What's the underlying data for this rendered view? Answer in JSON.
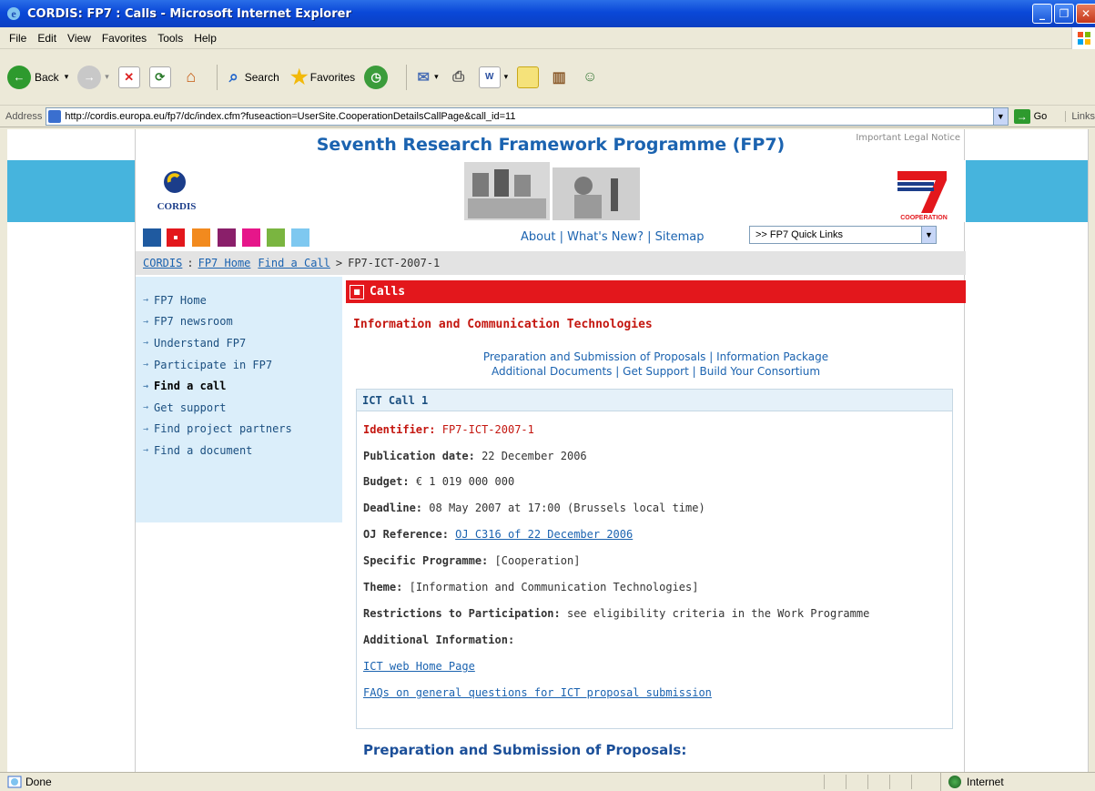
{
  "window": {
    "title": "CORDIS: FP7 : Calls - Microsoft Internet Explorer",
    "controls": [
      "minimize",
      "restore",
      "close"
    ]
  },
  "menu": [
    "File",
    "Edit",
    "View",
    "Favorites",
    "Tools",
    "Help"
  ],
  "toolbar": {
    "back": "Back",
    "search": "Search",
    "favorites": "Favorites"
  },
  "address": {
    "label": "Address",
    "url": "http://cordis.europa.eu/fp7/dc/index.cfm?fuseaction=UserSite.CooperationDetailsCallPage&call_id=11",
    "go": "Go",
    "links": "Links"
  },
  "header": {
    "title": "Seventh Research Framework Programme (FP7)",
    "legal": "Important Legal Notice",
    "cordis_logo": "CORDIS",
    "cooperation_badge": "COOPERATION",
    "swatch_colors": [
      "#1f5aa0",
      "#e3171c",
      "#f28a1e",
      "#8a1f6a",
      "#e6168a",
      "#7ab540",
      "#7ec8f0"
    ]
  },
  "toplinks": {
    "about": "About",
    "whats_new": "What's New?",
    "sitemap": "Sitemap",
    "sep": "|"
  },
  "quicklinks": {
    "value": ">> FP7 Quick Links"
  },
  "breadcrumb": {
    "cordis": "CORDIS",
    "colon": ":",
    "fp7home": "FP7 Home",
    "findcall": "Find a Call",
    "gt": ">",
    "current": "FP7-ICT-2007-1"
  },
  "sidebar": {
    "items": [
      {
        "label": "FP7 Home"
      },
      {
        "label": "FP7 newsroom"
      },
      {
        "label": "Understand FP7"
      },
      {
        "label": "Participate in FP7"
      },
      {
        "label": "Find a call"
      },
      {
        "label": "Get support"
      },
      {
        "label": "Find project partners"
      },
      {
        "label": "Find a document"
      }
    ]
  },
  "main": {
    "section": "Calls",
    "theme_heading": "Information and Communication Technologies",
    "links": {
      "prep": "Preparation and Submission of Proposals",
      "infopack": "Information Package",
      "adddocs": "Additional Documents",
      "support": "Get Support",
      "consortium": "Build Your Consortium",
      "sep": "|"
    },
    "call": {
      "title": "ICT Call 1",
      "identifier_label": "Identifier:",
      "identifier": "FP7-ICT-2007-1",
      "pubdate_label": "Publication date:",
      "pubdate": "22 December 2006",
      "budget_label": "Budget:",
      "budget": "€ 1 019 000 000",
      "deadline_label": "Deadline:",
      "deadline": "08 May 2007 at 17:00 (Brussels local time)",
      "oj_label": "OJ Reference:",
      "oj": "OJ C316 of 22 December 2006",
      "programme_label": "Specific Programme:",
      "programme": "[Cooperation]",
      "theme_label": "Theme:",
      "theme": "[Information and Communication Technologies]",
      "restrictions_label": "Restrictions to Participation:",
      "restrictions": "see eligibility criteria in the Work Programme",
      "addinfo_label": "Additional Information:",
      "link1": "ICT web Home Page",
      "link2": "FAQs on general questions for ICT proposal submission"
    },
    "subheading": "Preparation and Submission of Proposals:"
  },
  "status": {
    "text": "Done",
    "zone": "Internet"
  }
}
